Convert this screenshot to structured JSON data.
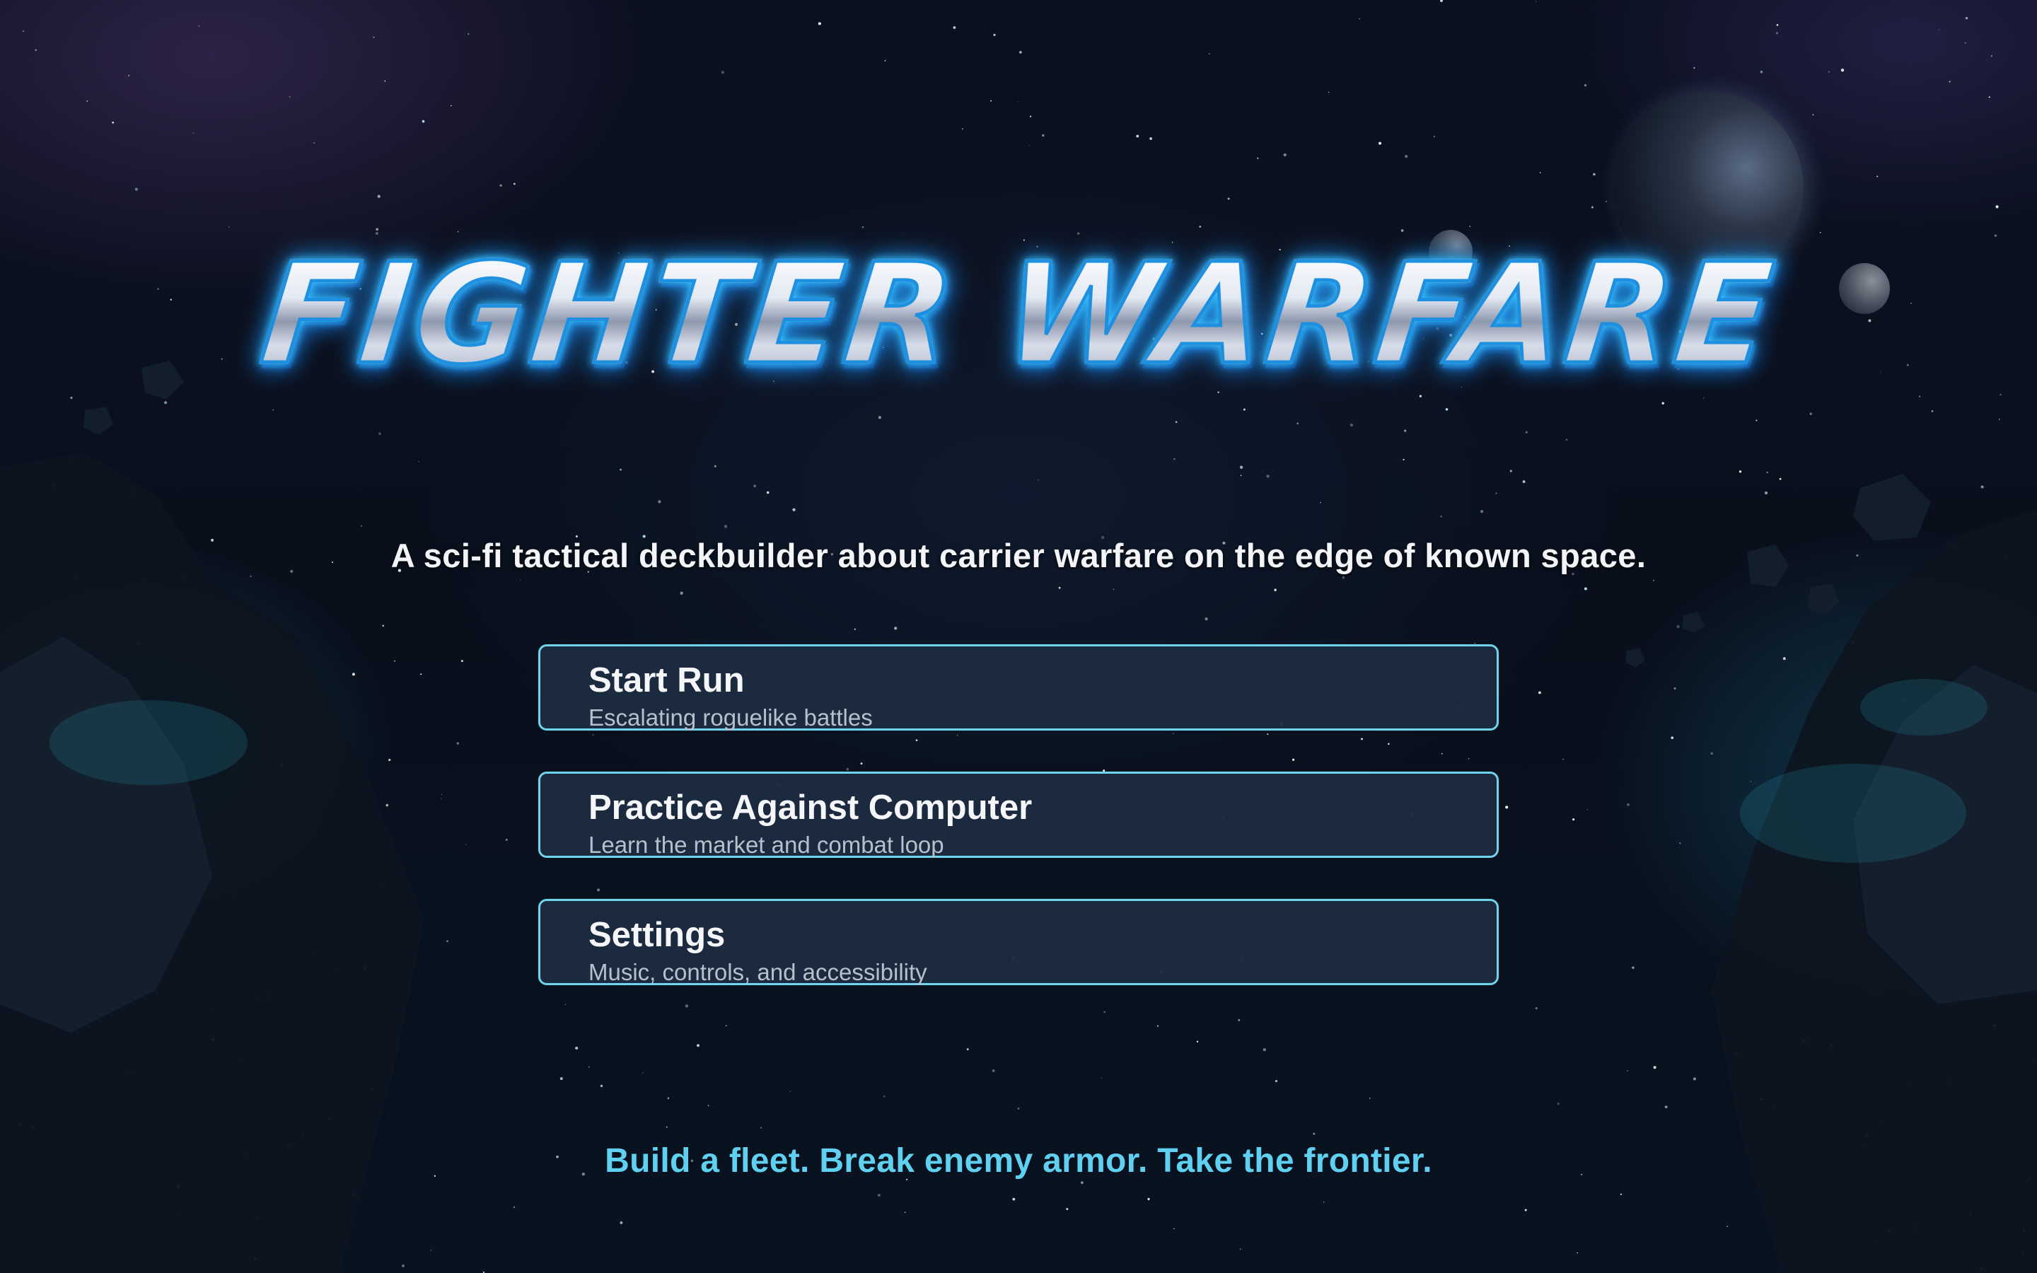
{
  "game": {
    "logo_text": "FIGHTER WARFARE",
    "tagline": "A sci-fi tactical deckbuilder about carrier warfare on the edge of known space.",
    "footer": "Build a fleet. Break enemy armor. Take the frontier."
  },
  "menu": {
    "items": [
      {
        "label": "Start Run",
        "description": "Escalating roguelike battles"
      },
      {
        "label": "Practice Against Computer",
        "description": "Learn the market and combat loop"
      },
      {
        "label": "Settings",
        "description": "Music, controls, and accessibility"
      }
    ]
  },
  "colors": {
    "accent": "#6fd4ee",
    "button_fill": "#1c2c40",
    "footer_text": "#5fd0ef",
    "logo_glow": "#38c6ff"
  }
}
